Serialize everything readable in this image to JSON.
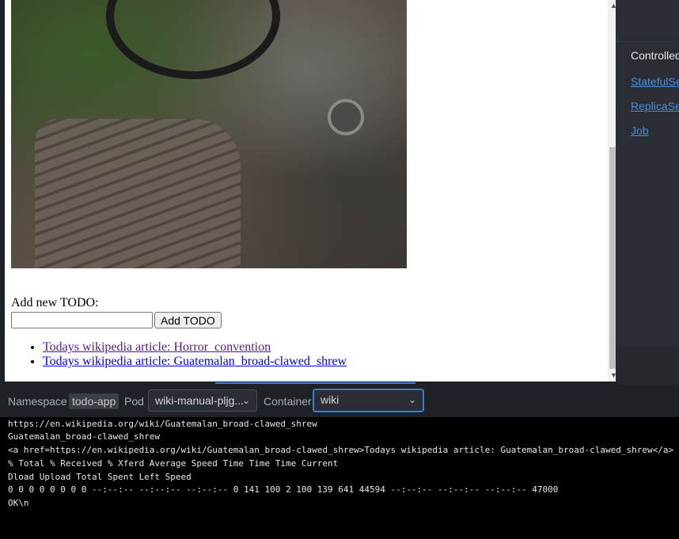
{
  "right_panel": {
    "heading": "Controlled",
    "links": [
      "StatefulSet",
      "ReplicaSet",
      "Job"
    ]
  },
  "webview": {
    "todo_label": "Add new TODO:",
    "todo_input_value": "",
    "add_button_label": "Add TODO",
    "todos": [
      "Todays wikipedia article: Horror_convention",
      "Todays wikipedia article: Guatemalan_broad-clawed_shrew"
    ]
  },
  "toolbar": {
    "namespace_label": "Namespace",
    "namespace_value": "todo-app",
    "pod_label": "Pod",
    "pod_value": "wiki-manual-pljg...",
    "container_label": "Container",
    "container_value": "wiki"
  },
  "terminal": {
    "lines": [
      "https://en.wikipedia.org/wiki/Guatemalan_broad-clawed_shrew",
      "Guatemalan_broad-clawed_shrew",
      "<a href=https://en.wikipedia.org/wiki/Guatemalan_broad-clawed_shrew>Todays wikipedia article: Guatemalan_broad-clawed_shrew</a>",
      "% Total % Received % Xferd Average Speed Time Time Time Current",
      "Dload Upload Total Spent Left Speed",
      "0 0 0 0 0 0 0 0 --:--:-- --:--:-- --:--:-- 0 141 100 2 100 139 641 44594 --:--:-- --:--:-- --:--:-- 47000",
      "OK\\n"
    ]
  },
  "colors": {
    "accent": "#3b7bd9",
    "link": "#4a90e2",
    "terminal_bg": "#000000",
    "panel_bg": "#2a2d33"
  }
}
